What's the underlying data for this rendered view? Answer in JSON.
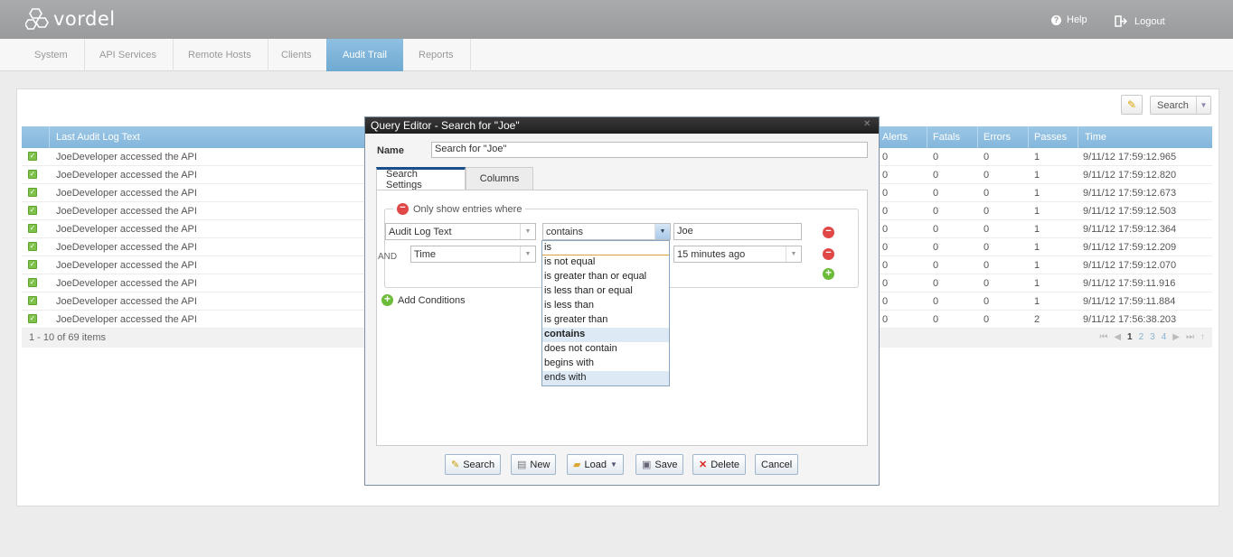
{
  "brand": {
    "name": "vordel"
  },
  "header": {
    "help": "Help",
    "logout": "Logout"
  },
  "tabs": [
    {
      "label": "System"
    },
    {
      "label": "API Services"
    },
    {
      "label": "Remote Hosts"
    },
    {
      "label": "Clients"
    },
    {
      "label": "Audit Trail"
    },
    {
      "label": "Reports"
    }
  ],
  "toolbar": {
    "search_label": "Search"
  },
  "grid": {
    "columns": [
      "Last Audit Log Text",
      "Alerts",
      "Fatals",
      "Errors",
      "Passes",
      "Time"
    ],
    "rows": [
      {
        "text": "JoeDeveloper accessed the API",
        "alerts": "0",
        "fatals": "0",
        "errors": "0",
        "passes": "1",
        "time": "9/11/12 17:59:12.965"
      },
      {
        "text": "JoeDeveloper accessed the API",
        "alerts": "0",
        "fatals": "0",
        "errors": "0",
        "passes": "1",
        "time": "9/11/12 17:59:12.820"
      },
      {
        "text": "JoeDeveloper accessed the API",
        "alerts": "0",
        "fatals": "0",
        "errors": "0",
        "passes": "1",
        "time": "9/11/12 17:59:12.673"
      },
      {
        "text": "JoeDeveloper accessed the API",
        "alerts": "0",
        "fatals": "0",
        "errors": "0",
        "passes": "1",
        "time": "9/11/12 17:59:12.503"
      },
      {
        "text": "JoeDeveloper accessed the API",
        "alerts": "0",
        "fatals": "0",
        "errors": "0",
        "passes": "1",
        "time": "9/11/12 17:59:12.364"
      },
      {
        "text": "JoeDeveloper accessed the API",
        "alerts": "0",
        "fatals": "0",
        "errors": "0",
        "passes": "1",
        "time": "9/11/12 17:59:12.209"
      },
      {
        "text": "JoeDeveloper accessed the API",
        "alerts": "0",
        "fatals": "0",
        "errors": "0",
        "passes": "1",
        "time": "9/11/12 17:59:12.070"
      },
      {
        "text": "JoeDeveloper accessed the API",
        "alerts": "0",
        "fatals": "0",
        "errors": "0",
        "passes": "1",
        "time": "9/11/12 17:59:11.916"
      },
      {
        "text": "JoeDeveloper accessed the API",
        "alerts": "0",
        "fatals": "0",
        "errors": "0",
        "passes": "1",
        "time": "9/11/12 17:59:11.884"
      },
      {
        "text": "JoeDeveloper accessed the API",
        "alerts": "0",
        "fatals": "0",
        "errors": "0",
        "passes": "2",
        "time": "9/11/12 17:56:38.203"
      }
    ],
    "footer": {
      "count": "1 - 10 of 69 items",
      "pages": [
        "1",
        "2",
        "3",
        "4"
      ],
      "current_page": "1"
    }
  },
  "modal": {
    "title": "Query Editor - Search for \"Joe\"",
    "name_label": "Name",
    "name_value": "Search for \"Joe\"",
    "tabs": [
      "Search Settings",
      "Columns"
    ],
    "legend": "Only show entries where",
    "and_label": "AND",
    "conditions": [
      {
        "field": "Audit Log Text",
        "operator": "contains",
        "value": "Joe"
      },
      {
        "field": "Time",
        "operator": "is",
        "value": "15 minutes ago"
      }
    ],
    "add_conditions": "Add Conditions",
    "operator_options": [
      "is",
      "is not equal",
      "is greater than or equal",
      "is less than or equal",
      "is less than",
      "is greater than",
      "contains",
      "does not contain",
      "begins with",
      "ends with"
    ],
    "selected_operator": "contains",
    "buttons": {
      "search": "Search",
      "new": "New",
      "load": "Load",
      "save": "Save",
      "delete": "Delete",
      "cancel": "Cancel"
    }
  },
  "colors": {
    "accent": "#7fb2d9",
    "header_bg": "#a4a6a8",
    "dialog_title": "#2a2a2a",
    "remove": "#e04848",
    "add": "#6cbc3a"
  }
}
